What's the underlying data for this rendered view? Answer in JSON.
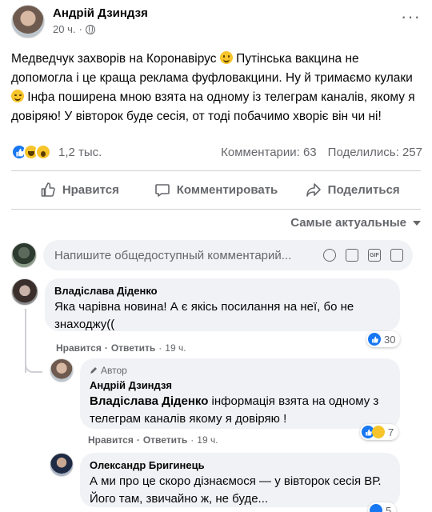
{
  "post": {
    "author": "Андрій Дзиндзя",
    "time": "20 ч.",
    "more": "···",
    "text_1": "Медведчук захворів на Коронавірус",
    "text_2": " Путінська вакцина не допомогла і це краща реклама фуфловакцини. Ну й тримаємо кулаки",
    "text_3": " Інфа  поширена мною взята на одному із телеграм каналів, якому я довіряю! У вівторок буде сесія, от тоді побачимо хворіє він чи ні!"
  },
  "stats": {
    "reactions_count": "1,2 тыс.",
    "comments": "Комментарии: 63",
    "shares": "Поделились: 257"
  },
  "actions": {
    "like": "Нравится",
    "comment": "Комментировать",
    "share": "Поделиться"
  },
  "sort": {
    "label": "Самые актуальные"
  },
  "composer": {
    "placeholder": "Напишите общедоступный комментарий..."
  },
  "comments": [
    {
      "name": "Владіслава Діденко",
      "text": "Яка чарівна новина! А є якісь посилання на неї, бо не знаходжу((",
      "like": "Нравится",
      "reply": "Ответить",
      "time": "19 ч.",
      "reactions": "30"
    },
    {
      "author_tag": "Автор",
      "name": "Андрій Дзиндзя",
      "mention": "Владіслава Діденко",
      "text": " інформація взята на одному з телеграм каналів якому я довіряю !",
      "like": "Нравится",
      "reply": "Ответить",
      "time": "19 ч.",
      "reactions": "7"
    },
    {
      "name": "Олександр Бригинець",
      "text": "А ми про це скоро дізнаємося — у вівторок сесія ВР. Його там, звичайно ж, не буде...",
      "reactions": "5"
    }
  ],
  "colors": {
    "like_blue": "#1877f2",
    "haha_yellow": "#f7c52b",
    "muted": "#65676b",
    "bubble": "#f0f2f5"
  }
}
